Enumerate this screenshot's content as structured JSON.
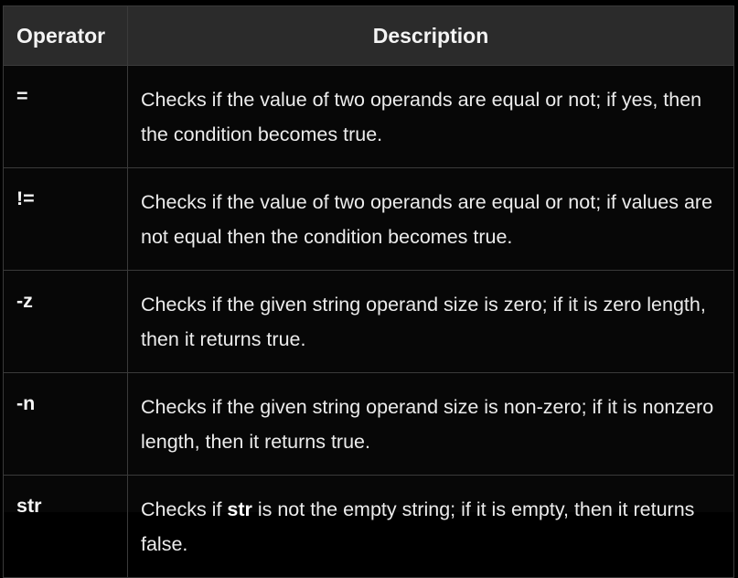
{
  "table": {
    "headers": {
      "operator": "Operator",
      "description": "Description"
    },
    "rows": [
      {
        "operator": "=",
        "description": "Checks if the value of two operands are equal or not; if yes, then the condition becomes true."
      },
      {
        "operator": "!=",
        "description": "Checks if the value of two operands are equal or not; if values are not equal then the condition becomes true."
      },
      {
        "operator": "-z",
        "description": "Checks if the given string operand size is zero; if it is zero length, then it returns true."
      },
      {
        "operator": "-n",
        "description": "Checks if the given string operand size is non-zero; if it is nonzero length, then it returns true."
      },
      {
        "operator": "str",
        "description_pre": "Checks if ",
        "description_strong": "str",
        "description_post": " is not the empty string; if it is empty, then it returns false."
      }
    ]
  }
}
